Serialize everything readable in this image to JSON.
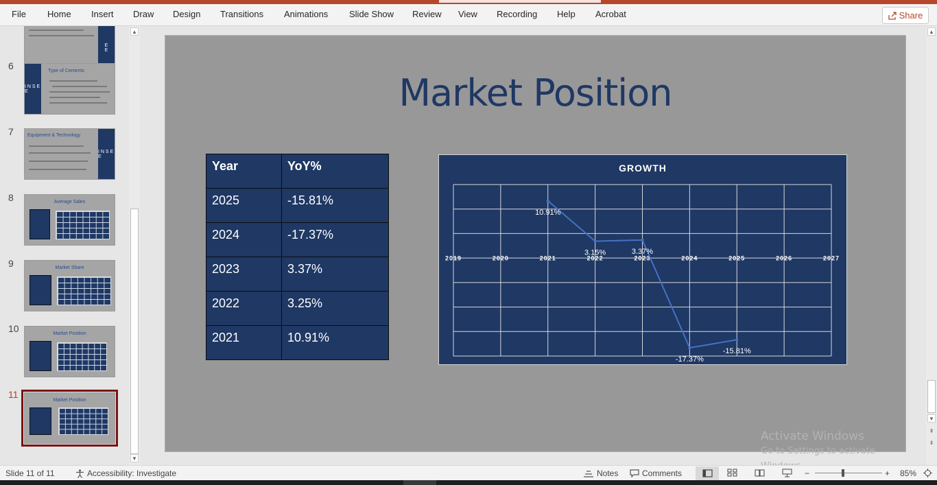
{
  "ribbon": {
    "tabs": [
      "File",
      "Home",
      "Insert",
      "Draw",
      "Design",
      "Transitions",
      "Animations",
      "Slide Show",
      "Review",
      "View",
      "Recording",
      "Help",
      "Acrobat"
    ],
    "share_label": "Share"
  },
  "thumbnails": [
    {
      "number": "6",
      "title": "Type of Cements",
      "side_text": "I N S E E"
    },
    {
      "number": "7",
      "title": "Equipment & Technology",
      "side_text": "I N S E E"
    },
    {
      "number": "8",
      "title": "Average Sales"
    },
    {
      "number": "9",
      "title": "Market Share"
    },
    {
      "number": "10",
      "title": "Market Position"
    },
    {
      "number": "11",
      "title": "Market Position",
      "active": true
    }
  ],
  "slide": {
    "title": "Market Position",
    "table": {
      "headers": [
        "Year",
        "YoY%"
      ],
      "rows": [
        [
          "2025",
          "-15.81%"
        ],
        [
          "2024",
          "-17.37%"
        ],
        [
          "2023",
          "3.37%"
        ],
        [
          "2022",
          "3.25%"
        ],
        [
          "2021",
          "10.91%"
        ]
      ]
    }
  },
  "chart_data": {
    "type": "line",
    "title": "GROWTH",
    "xlim": [
      2019,
      2027
    ],
    "x_ticks": [
      "2019",
      "2020",
      "2021",
      "2022",
      "2023",
      "2024",
      "2025",
      "2026",
      "2027"
    ],
    "series": [
      {
        "x": [
          2021,
          2022,
          2023,
          2024,
          2025
        ],
        "values": [
          10.91,
          3.15,
          3.37,
          -17.37,
          -15.81
        ],
        "labels": [
          "10.91%",
          "3.15%",
          "3.37%",
          "-17.37%",
          "-15.81%"
        ],
        "color": "#4472c4"
      }
    ],
    "ylim": [
      -18.95,
      14.05
    ],
    "grid": true,
    "legend": "none"
  },
  "watermark": {
    "line1": "Activate Windows",
    "line2": "Go to Settings to activate Windows."
  },
  "status": {
    "slide_info": "Slide 11 of 11",
    "accessibility": "Accessibility: Investigate",
    "notes": "Notes",
    "comments": "Comments",
    "zoom": "85%"
  }
}
